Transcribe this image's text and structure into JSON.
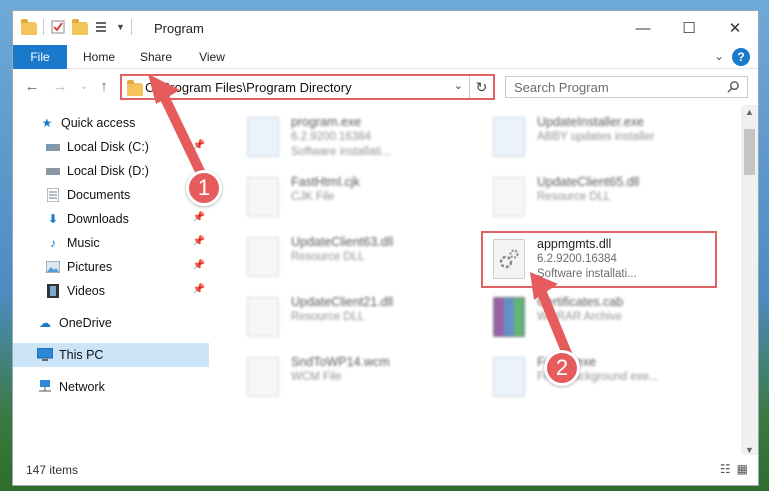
{
  "window": {
    "title": "Program",
    "controls": {
      "minimize": "—",
      "maximize": "☐",
      "close": "✕"
    }
  },
  "ribbon": {
    "tabs": [
      "File",
      "Home",
      "Share",
      "View"
    ],
    "help": "?"
  },
  "address": {
    "path": "C:\\Program Files\\Program Directory",
    "refresh_icon": "refresh-icon"
  },
  "search": {
    "placeholder": "Search Program"
  },
  "sidebar": {
    "items": [
      {
        "label": "Quick access",
        "icon": "star-icon"
      },
      {
        "label": "Local Disk (C:)",
        "icon": "drive-icon",
        "pinned": true
      },
      {
        "label": "Local Disk (D:)",
        "icon": "drive-icon"
      },
      {
        "label": "Documents",
        "icon": "documents-icon"
      },
      {
        "label": "Downloads",
        "icon": "download-icon",
        "pinned": true
      },
      {
        "label": "Music",
        "icon": "music-icon",
        "pinned": true
      },
      {
        "label": "Pictures",
        "icon": "pictures-icon",
        "pinned": true
      },
      {
        "label": "Videos",
        "icon": "videos-icon",
        "pinned": true
      },
      {
        "label": "OneDrive",
        "icon": "cloud-icon"
      },
      {
        "label": "This PC",
        "icon": "computer-icon",
        "selected": true
      },
      {
        "label": "Network",
        "icon": "network-icon"
      }
    ]
  },
  "files": [
    {
      "name": "program.exe",
      "line1": "6.2.9200.16384",
      "line2": "Software installati...",
      "kind": "app"
    },
    {
      "name": "UpdateInstaller.exe",
      "line1": "ABBY updates installer",
      "line2": "",
      "kind": "app"
    },
    {
      "name": "FastHtml.cjk",
      "line1": "CJK File",
      "line2": "",
      "kind": "doc"
    },
    {
      "name": "UpdateClient65.dll",
      "line1": "Resource DLL",
      "line2": "",
      "kind": "dll"
    },
    {
      "name": "UpdateClient63.dll",
      "line1": "Resource DLL",
      "line2": "",
      "kind": "dll"
    },
    {
      "name": "appmgmts.dll",
      "line1": "6.2.9200.16384",
      "line2": "Software installati...",
      "kind": "dll"
    },
    {
      "name": "UpdateClient21.dll",
      "line1": "Resource DLL",
      "line2": "",
      "kind": "dll"
    },
    {
      "name": "Certificates.cab",
      "line1": "WinRAR Archive",
      "line2": "",
      "kind": "rar"
    },
    {
      "name": "SndToWP14.wcm",
      "line1": "WCM File",
      "line2": "",
      "kind": "doc"
    },
    {
      "name": "Frontc.exe",
      "line1": "Front background exe...",
      "line2": "",
      "kind": "app"
    }
  ],
  "status": {
    "count": "147 items"
  },
  "callouts": [
    "1",
    "2"
  ],
  "colors": {
    "accent": "#1979ca",
    "callout": "#e65c5c",
    "selected": "#cce4f7"
  }
}
